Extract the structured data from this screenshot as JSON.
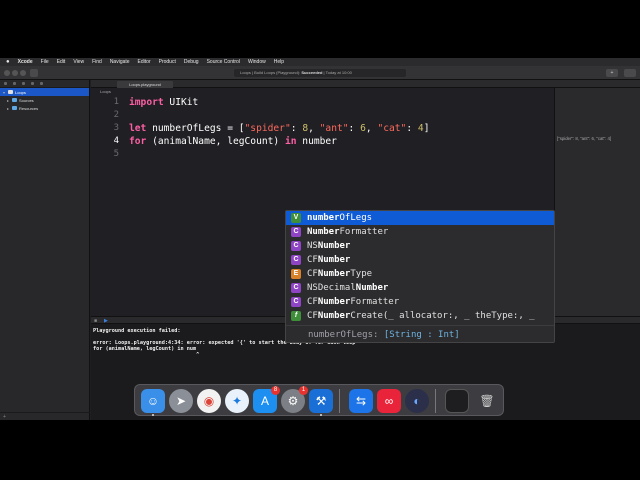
{
  "menubar": {
    "app": "Xcode",
    "items": [
      "File",
      "Edit",
      "View",
      "Find",
      "Navigate",
      "Editor",
      "Product",
      "Debug",
      "Source Control",
      "Window",
      "Help"
    ]
  },
  "toolbar": {
    "status_prefix": "Loops | Build Loops (Playground): ",
    "status_result": "Succeeded",
    "status_suffix": " | Today at 10:00",
    "add_label": "+"
  },
  "navigator": {
    "items": [
      {
        "label": "Loops",
        "level": 0,
        "selected": true
      },
      {
        "label": "Sources",
        "level": 1,
        "selected": false
      },
      {
        "label": "Resources",
        "level": 1,
        "selected": false
      }
    ],
    "filter_icon": "+"
  },
  "editor": {
    "tab": "Loops.playground",
    "jump_path": "Loops",
    "line_numbers": [
      "1",
      "2",
      "3",
      "4",
      "5"
    ],
    "current_line": "4",
    "result_sidebar": "[\"spider\": 8, \"ant\": 6, \"cat\": 4]"
  },
  "code": {
    "line1_kw": "import",
    "line1_rest": " UIKit",
    "line3_kw": "let",
    "line3_a": " numberOfLegs = [",
    "line3_s1": "\"spider\"",
    "line3_c1": ": ",
    "line3_n1": "8",
    "line3_c2": ", ",
    "line3_s2": "\"ant\"",
    "line3_c3": ": ",
    "line3_n2": "6",
    "line3_c4": ", ",
    "line3_s3": "\"cat\"",
    "line3_c5": ": ",
    "line3_n3": "4",
    "line3_end": "]",
    "line4_kw1": "for",
    "line4_mid": " (animalName, legCount) ",
    "line4_kw2": "in",
    "line4_end": " number"
  },
  "completion": {
    "items": [
      {
        "kind": "V",
        "color": "#3f8f3a",
        "match": "number",
        "rest": "OfLegs",
        "pre": "",
        "selected": true
      },
      {
        "kind": "C",
        "color": "#8e44c4",
        "match": "Number",
        "rest": "Formatter",
        "pre": "",
        "selected": false
      },
      {
        "kind": "C",
        "color": "#8e44c4",
        "match": "Number",
        "rest": "",
        "pre": "NS",
        "selected": false
      },
      {
        "kind": "C",
        "color": "#8e44c4",
        "match": "Number",
        "rest": "",
        "pre": "CF",
        "selected": false
      },
      {
        "kind": "E",
        "color": "#d8812b",
        "match": "Number",
        "rest": "Type",
        "pre": "CF",
        "selected": false
      },
      {
        "kind": "C",
        "color": "#8e44c4",
        "match": "Number",
        "rest": "",
        "pre": "NSDecimal",
        "selected": false
      },
      {
        "kind": "C",
        "color": "#8e44c4",
        "match": "Number",
        "rest": "Formatter",
        "pre": "CF",
        "selected": false
      },
      {
        "kind": "f",
        "color": "#3f8f3a",
        "match": "Number",
        "rest": "Create(_ allocator:, _ theType:, _",
        "pre": "CF",
        "selected": false
      }
    ],
    "detail_name": "numberOfLegs: ",
    "detail_type": "[String : Int]"
  },
  "console": {
    "line1": "Playground execution failed:",
    "line2": "error: Loops.playground:4:34: error: expected '{' to start the body of for-each loop",
    "line3": "for (animalName, legCount) in num",
    "line4": "                                 ^"
  },
  "dock": {
    "appstore_badge": "8",
    "prefs_badge": "1"
  }
}
